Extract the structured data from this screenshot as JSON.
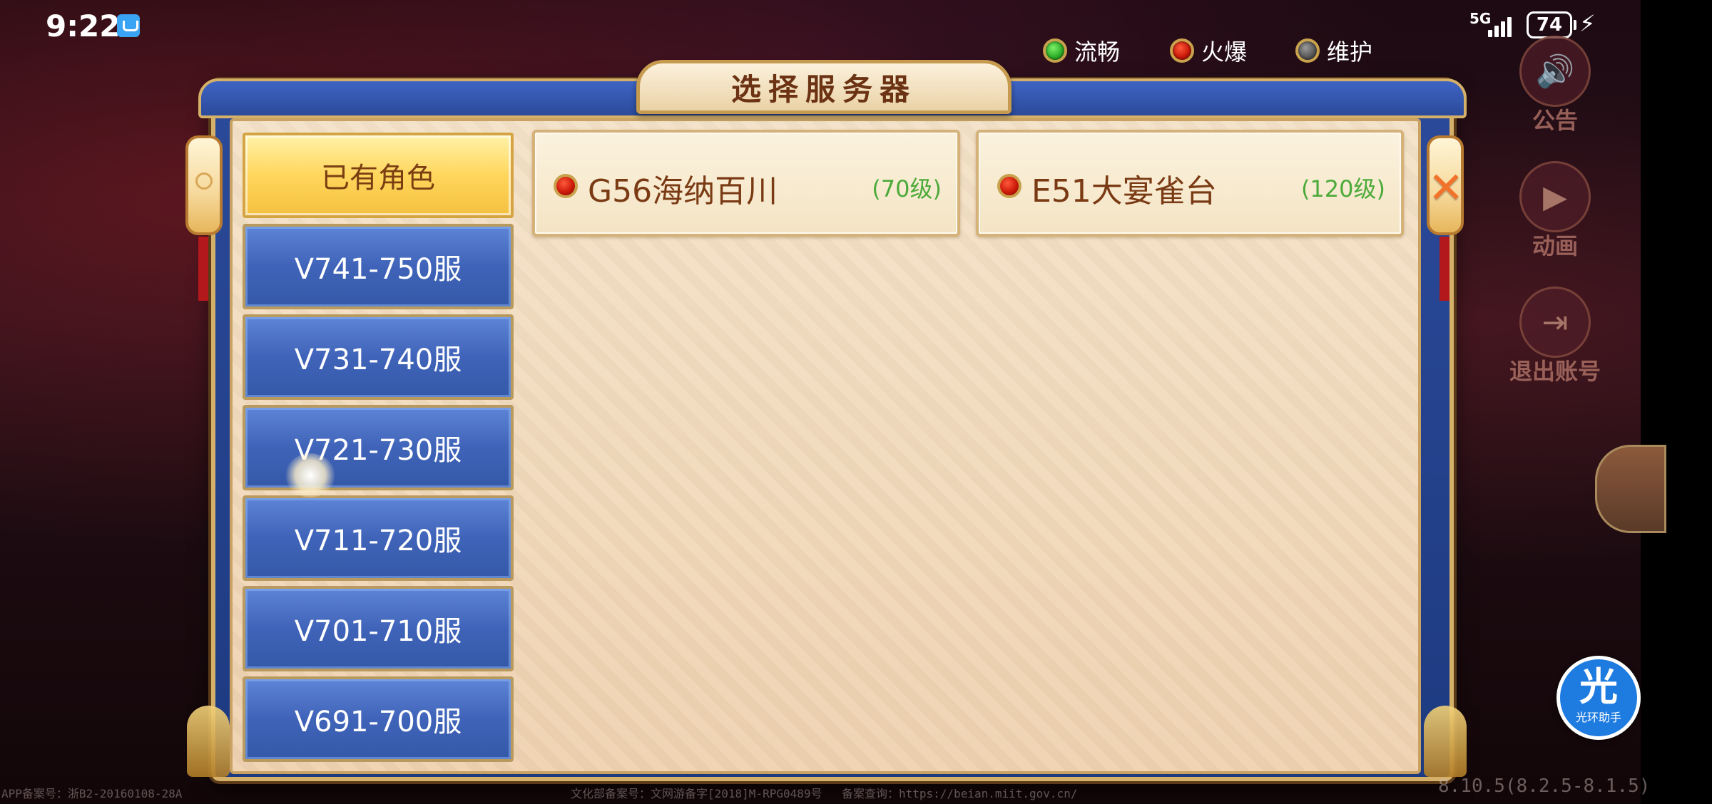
{
  "status_bar": {
    "time": "9:22",
    "network": "5G",
    "battery": "74"
  },
  "legend": [
    {
      "label": "流畅",
      "color": "#2fb12a"
    },
    {
      "label": "火爆",
      "color": "#e02a16"
    },
    {
      "label": "维护",
      "color": "#5a5a5a"
    }
  ],
  "dialog": {
    "title": "选择服务器",
    "close_icon": "close-icon"
  },
  "tabs": [
    {
      "label": "已有角色",
      "active": true
    },
    {
      "label": "V741-750服",
      "active": false
    },
    {
      "label": "V731-740服",
      "active": false
    },
    {
      "label": "V721-730服",
      "active": false
    },
    {
      "label": "V711-720服",
      "active": false
    },
    {
      "label": "V701-710服",
      "active": false
    },
    {
      "label": "V691-700服",
      "active": false
    }
  ],
  "servers": [
    {
      "name": "G56海纳百川",
      "level": "(70级)",
      "status": "hot",
      "status_color": "#e02a16"
    },
    {
      "name": "E51大宴雀台",
      "level": "(120级)",
      "status": "hot",
      "status_color": "#e02a16"
    }
  ],
  "side_buttons": [
    {
      "label": "公告",
      "icon": "speaker-icon"
    },
    {
      "label": "动画",
      "icon": "play-icon"
    },
    {
      "label": "退出账号",
      "icon": "logout-icon"
    }
  ],
  "assistant": {
    "glyph": "光",
    "label": "光环助手"
  },
  "footer": {
    "app_record": "APP备案号：浙B2-20160108-28A",
    "culture_record": "文化部备案号：文网游备字[2018]M-RPG0489号",
    "record_query": "备案查询：https://beian.miit.gov.cn/",
    "version": "8.10.5(8.2.5-8.1.5)"
  },
  "colors": {
    "accent_gold": "#d4b069",
    "panel_blue": "#2b4a9a",
    "active_tab": "#ffd65c",
    "level_green": "#4caa3a"
  }
}
